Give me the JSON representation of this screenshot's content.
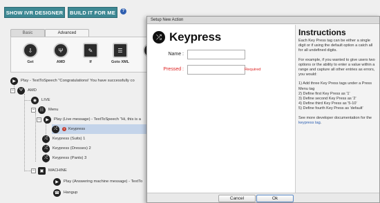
{
  "toolbar": {
    "ivr_designer": "SHOW IVR DESIGNER",
    "build_for_me": "BUILD IT FOR ME",
    "help": "?"
  },
  "tabs": {
    "basic": "Basic",
    "advanced": "Advanced"
  },
  "tools": [
    {
      "label": "Get",
      "icon": "download-icon"
    },
    {
      "label": "AMD",
      "icon": "antenna-icon"
    },
    {
      "label": "If",
      "icon": "condition-icon"
    },
    {
      "label": "Goto XML",
      "icon": "document-icon"
    }
  ],
  "tree": {
    "play_tts": "Play - TextToSpeech \"Congratulations! You have successfully co",
    "amd": "AMD",
    "live": "LIVE",
    "menu": "Menu",
    "play_live": "Play (Live message) - TextToSpeech \"Hi, this is a",
    "keypress": "Keypress",
    "kp_suits": "Keypress (Suits) 1",
    "kp_dresses": "Keypress (Dresses) 2",
    "kp_pants": "Keypress (Pants) 3",
    "machine": "MACHINE",
    "play_machine": "Play (Answering machine message) - TextTo",
    "hangup": "Hangup"
  },
  "dialog": {
    "title": "Setup New Action",
    "heading": "Keypress",
    "name_label": "Name :",
    "name_value": "",
    "pressed_label": "Pressed :",
    "pressed_value": "",
    "required": "Required",
    "cancel": "Cancel",
    "ok": "Ok"
  },
  "instructions": {
    "title": "Instructions",
    "p1": "Each Key Press tag can be either a single digit or if using the default option a catch all for all undefined digits.",
    "p2": "For example, if you wanted to give users two options or the ability to enter a value within a range and capture all other entries as errors, you would:",
    "steps": [
      "1) Add three Key Press tags under a Press Menu tag",
      "2) Define first Key Press as '1'",
      "3) Define second Key Press as '2'",
      "4) Define third Key Press as '5-10'",
      "5) Define fourth Key Press as 'default'"
    ],
    "p3_prefix": "See more developer documentation for the ",
    "p3_link": "keypress tag",
    "p3_suffix": "."
  },
  "colors": {
    "accent": "#3d8893",
    "required": "#dd2222",
    "link": "#2a5db0"
  }
}
